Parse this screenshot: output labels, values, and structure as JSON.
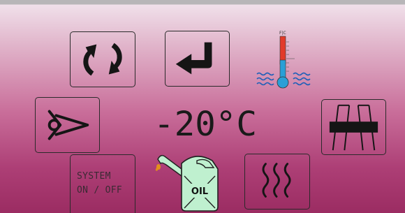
{
  "temperature": {
    "value": "-20°C"
  },
  "thermometer": {
    "scale_label": "F|C"
  },
  "system_button": {
    "label": "SYSTEM\nON / OFF"
  },
  "oil_indicator": {
    "label": "OIL"
  },
  "icons": [
    "rotate-arrows-icon",
    "enter-return-icon",
    "coolant-temperature-icon",
    "eye-icon",
    "highway-icon",
    "oil-can-icon",
    "heat-waves-icon"
  ],
  "colors": {
    "background_top": "#f0e0ea",
    "background_bottom": "#9b2c62",
    "icon_stroke": "#1a1a1a",
    "thermo_red": "#e23b2a",
    "thermo_blue": "#2a9fd6",
    "oil_green": "#bff0cf"
  }
}
